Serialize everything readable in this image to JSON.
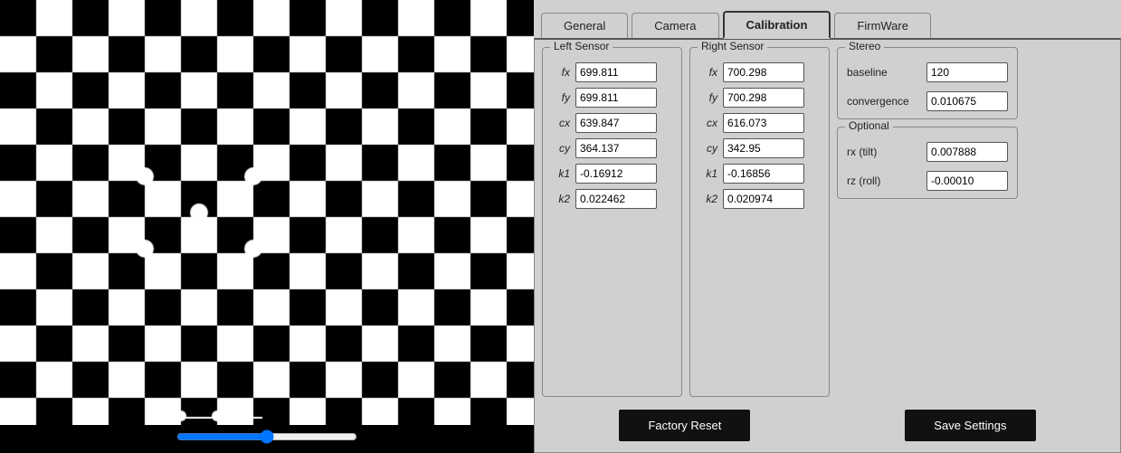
{
  "tabs": [
    {
      "label": "General",
      "active": false
    },
    {
      "label": "Camera",
      "active": false
    },
    {
      "label": "Calibration",
      "active": true
    },
    {
      "label": "FirmWare",
      "active": false
    }
  ],
  "left_sensor": {
    "group_label": "Left Sensor",
    "fields": [
      {
        "label": "fx",
        "value": "699.811"
      },
      {
        "label": "fy",
        "value": "699.811"
      },
      {
        "label": "cx",
        "value": "639.847"
      },
      {
        "label": "cy",
        "value": "364.137"
      },
      {
        "label": "k1",
        "value": "-0.16912"
      },
      {
        "label": "k2",
        "value": "0.022462"
      }
    ]
  },
  "right_sensor": {
    "group_label": "Right Sensor",
    "fields": [
      {
        "label": "fx",
        "value": "700.298"
      },
      {
        "label": "fy",
        "value": "700.298"
      },
      {
        "label": "cx",
        "value": "616.073"
      },
      {
        "label": "cy",
        "value": "342.95"
      },
      {
        "label": "k1",
        "value": "-0.16856"
      },
      {
        "label": "k2",
        "value": "0.020974"
      }
    ]
  },
  "stereo": {
    "group_label": "Stereo",
    "fields": [
      {
        "label": "baseline",
        "value": "120"
      },
      {
        "label": "convergence",
        "value": "0.010675"
      }
    ]
  },
  "optional": {
    "group_label": "Optional",
    "fields": [
      {
        "label": "rx (tilt)",
        "value": "0.007888"
      },
      {
        "label": "rz (roll)",
        "value": "-0.00010"
      }
    ]
  },
  "buttons": {
    "factory_reset": "Factory Reset",
    "save_settings": "Save Settings"
  }
}
